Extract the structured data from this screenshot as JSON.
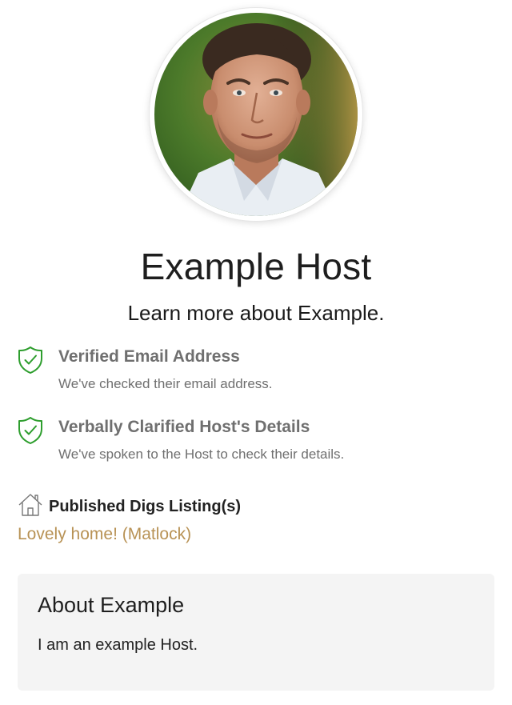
{
  "profile": {
    "name": "Example Host",
    "subtitle": "Learn more about Example."
  },
  "verifications": [
    {
      "icon": "shield-check-icon",
      "title": "Verified Email Address",
      "description": "We've checked their email address."
    },
    {
      "icon": "shield-check-icon",
      "title": "Verbally Clarified Host's Details",
      "description": "We've spoken to the Host to check their details."
    }
  ],
  "listings": {
    "icon": "house-icon",
    "title": "Published Digs Listing(s)",
    "items": [
      "Lovely home! (Matlock)"
    ]
  },
  "about": {
    "heading": "About Example",
    "body": "I am an example Host."
  },
  "colors": {
    "verified_green": "#2e9e2e",
    "link_gold": "#b89255",
    "muted_text": "#6f6f6f",
    "panel_bg": "#f4f4f4"
  }
}
